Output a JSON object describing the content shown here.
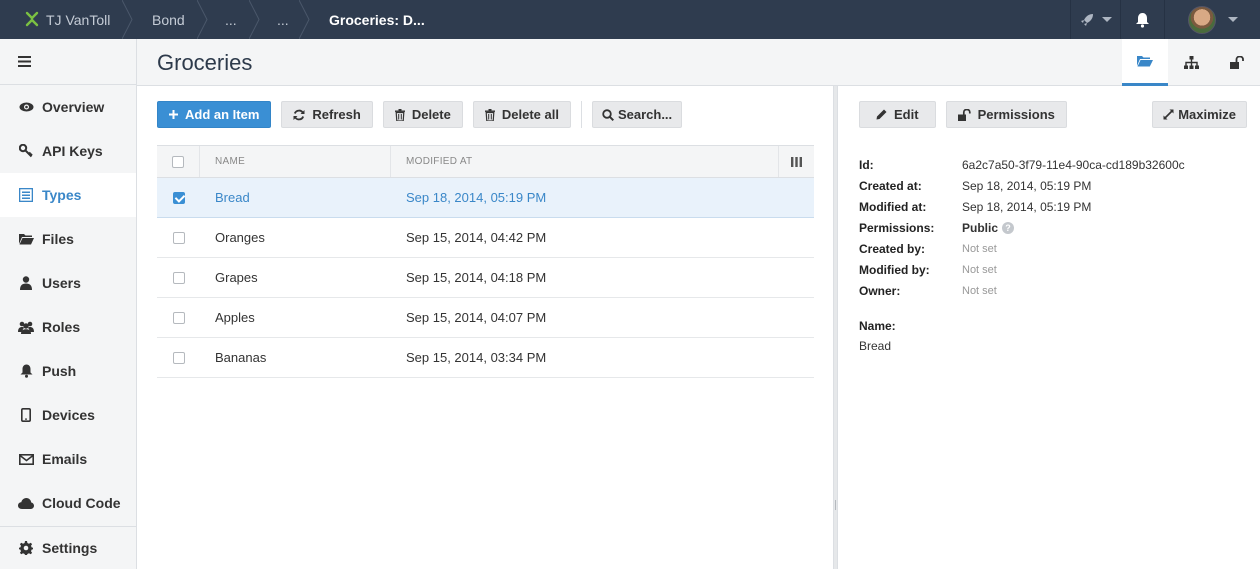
{
  "topbar": {
    "user": "TJ VanToll",
    "breadcrumbs": [
      "Bond",
      "...",
      "..."
    ],
    "current": "Groceries: D...",
    "icons": [
      "rocket-icon",
      "bell-icon"
    ]
  },
  "sidebar": {
    "items": [
      {
        "label": "Overview",
        "icon": "eye-icon"
      },
      {
        "label": "API Keys",
        "icon": "key-icon"
      },
      {
        "label": "Types",
        "icon": "list-icon",
        "active": true
      },
      {
        "label": "Files",
        "icon": "folder-icon"
      },
      {
        "label": "Users",
        "icon": "user-icon"
      },
      {
        "label": "Roles",
        "icon": "users-icon"
      },
      {
        "label": "Push",
        "icon": "bell-icon"
      },
      {
        "label": "Devices",
        "icon": "device-icon"
      },
      {
        "label": "Emails",
        "icon": "envelope-icon"
      },
      {
        "label": "Cloud Code",
        "icon": "cloud-icon"
      }
    ],
    "settings": "Settings"
  },
  "header": {
    "title": "Groceries",
    "tabs": [
      "folder-open-icon",
      "sitemap-icon",
      "unlock-icon"
    ]
  },
  "toolbar": {
    "add": "Add an Item",
    "refresh": "Refresh",
    "delete": "Delete",
    "delete_all": "Delete all",
    "search": "Search..."
  },
  "grid": {
    "columns": [
      "NAME",
      "MODIFIED AT"
    ],
    "rows": [
      {
        "name": "Bread",
        "modified": "Sep 18, 2014, 05:19 PM",
        "selected": true
      },
      {
        "name": "Oranges",
        "modified": "Sep 15, 2014, 04:42 PM",
        "selected": false
      },
      {
        "name": "Grapes",
        "modified": "Sep 15, 2014, 04:18 PM",
        "selected": false
      },
      {
        "name": "Apples",
        "modified": "Sep 15, 2014, 04:07 PM",
        "selected": false
      },
      {
        "name": "Bananas",
        "modified": "Sep 15, 2014, 03:34 PM",
        "selected": false
      }
    ]
  },
  "detail": {
    "edit": "Edit",
    "permissions": "Permissions",
    "maximize": "Maximize",
    "props": [
      {
        "k": "Id:",
        "v": "6a2c7a50-3f79-11e4-90ca-cd189b32600c"
      },
      {
        "k": "Created at:",
        "v": "Sep 18, 2014, 05:19 PM"
      },
      {
        "k": "Modified at:",
        "v": "Sep 18, 2014, 05:19 PM"
      },
      {
        "k": "Permissions:",
        "v": "Public"
      },
      {
        "k": "Created by:",
        "v": "Not set"
      },
      {
        "k": "Modified by:",
        "v": "Not set"
      },
      {
        "k": "Owner:",
        "v": "Not set"
      }
    ],
    "name_label": "Name:",
    "name_value": "Bread"
  },
  "colors": {
    "topbar": "#2f3c4f",
    "accent": "#3a8fd4",
    "sidebar": "#f4f5f6"
  }
}
